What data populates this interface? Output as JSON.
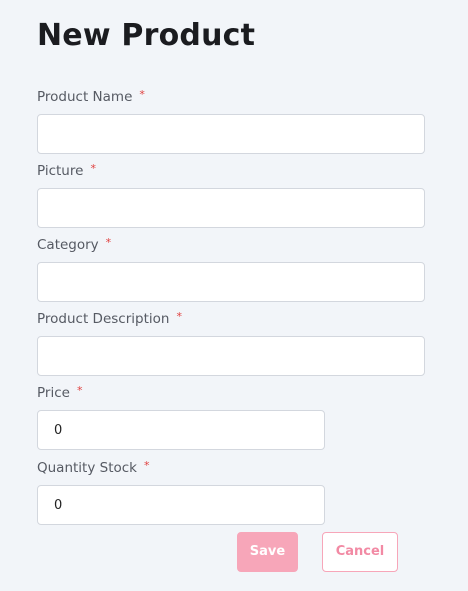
{
  "form": {
    "title": "New Product",
    "required_mark": "*",
    "fields": {
      "product_name": {
        "label": "Product Name",
        "value": ""
      },
      "picture": {
        "label": "Picture",
        "value": ""
      },
      "category": {
        "label": "Category",
        "value": ""
      },
      "product_description": {
        "label": "Product Description",
        "value": ""
      },
      "price": {
        "label": "Price",
        "value": "0"
      },
      "quantity_stock": {
        "label": "Quantity Stock",
        "value": "0"
      }
    },
    "save_label": "Save",
    "cancel_label": "Cancel"
  },
  "colors": {
    "background": "#f2f5f9",
    "accent": "#f7a6b9",
    "required": "#e0403f"
  }
}
